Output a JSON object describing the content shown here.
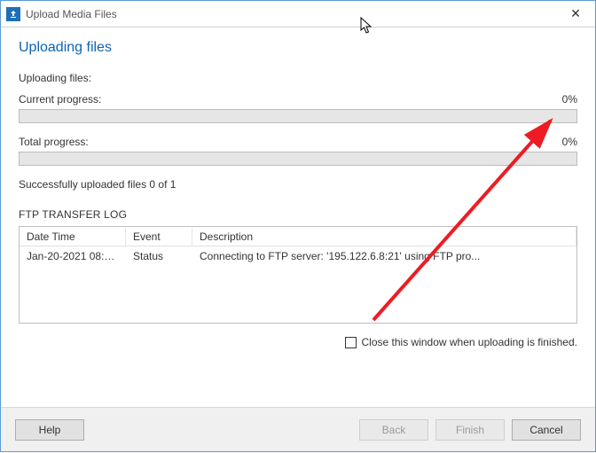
{
  "window": {
    "title": "Upload Media Files",
    "close_icon": "✕"
  },
  "heading": "Uploading files",
  "labels": {
    "uploading_files": "Uploading files:",
    "current_progress": "Current progress:",
    "total_progress": "Total progress:",
    "status": "Successfully uploaded files 0 of 1",
    "log_title": "FTP TRANSFER LOG",
    "close_when_done": "Close this window when uploading is finished."
  },
  "progress": {
    "current_pct": "0%",
    "total_pct": "0%"
  },
  "log": {
    "columns": {
      "datetime": "Date Time",
      "event": "Event",
      "description": "Description"
    },
    "rows": [
      {
        "datetime": "Jan-20-2021 08:5...",
        "event": "Status",
        "description": "Connecting to FTP server: '195.122.6.8:21' using FTP pro..."
      }
    ]
  },
  "buttons": {
    "help": "Help",
    "back": "Back",
    "finish": "Finish",
    "cancel": "Cancel"
  },
  "colors": {
    "accent": "#0b64b4",
    "link": "#1a3fbc",
    "arrow": "#ed1c24"
  }
}
